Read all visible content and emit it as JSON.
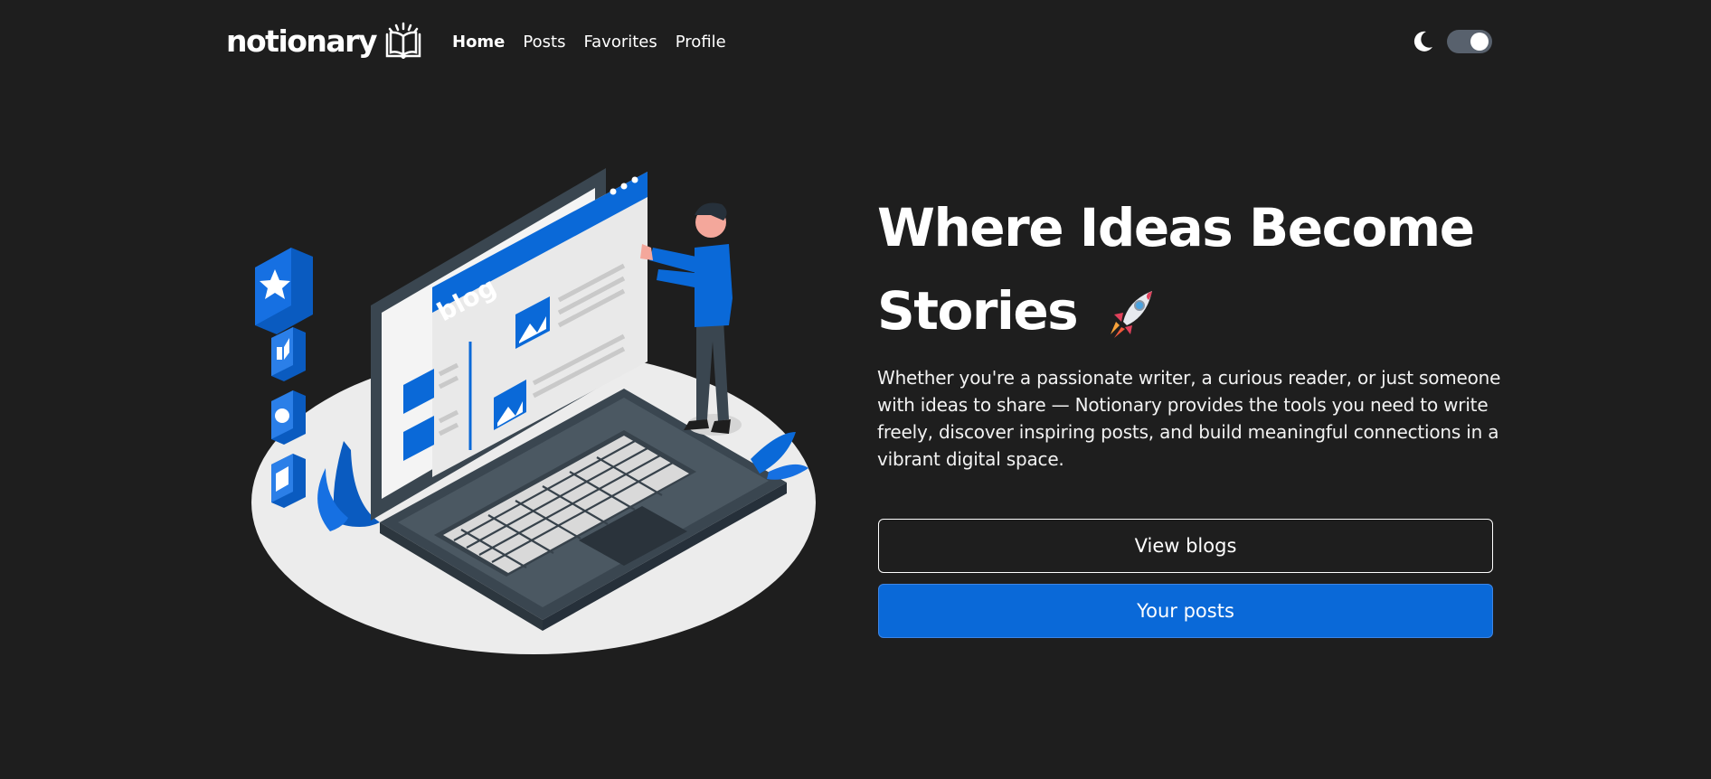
{
  "brand": {
    "name": "notionary",
    "icon": "open-book-icon"
  },
  "nav": {
    "items": [
      {
        "label": "Home",
        "active": true
      },
      {
        "label": "Posts",
        "active": false
      },
      {
        "label": "Favorites",
        "active": false
      },
      {
        "label": "Profile",
        "active": false
      }
    ]
  },
  "theme": {
    "icon": "moon-icon",
    "dark_mode_on": true
  },
  "hero": {
    "title_line1": "Where Ideas Become",
    "title_line2": "Stories",
    "title_emoji": "rocket-icon",
    "description": "Whether you're a passionate writer, a curious reader, or just someone with ideas to share — Notionary provides the tools you need to write freely, discover inspiring posts, and build meaningful connections in a vibrant digital space.",
    "illustration": {
      "screen_label": "blog"
    },
    "buttons": {
      "view_blogs": "View blogs",
      "your_posts": "Your posts"
    }
  },
  "colors": {
    "background": "#1e1e1e",
    "primary": "#0a69d8",
    "toggle_track": "#58616d",
    "text": "#ffffff"
  }
}
